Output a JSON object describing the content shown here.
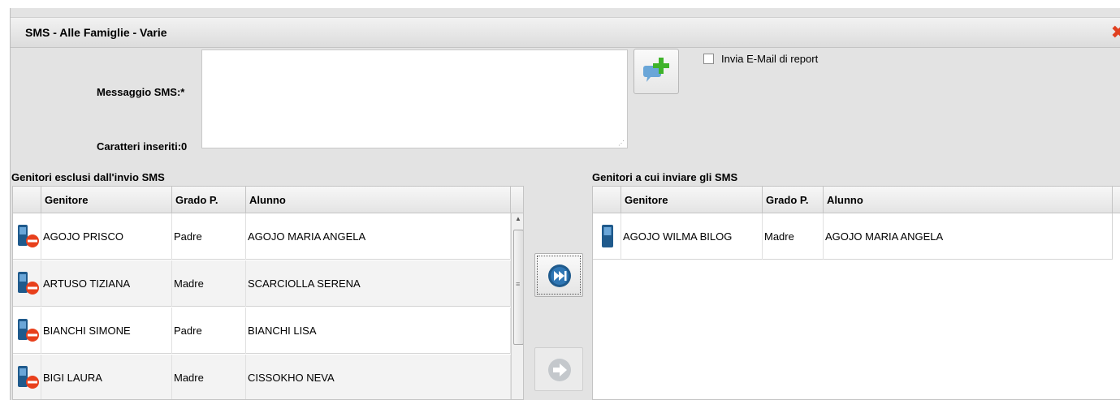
{
  "dialog": {
    "title": "SMS - Alle Famiglie - Varie",
    "close_icon": "close-x-icon"
  },
  "form": {
    "message_label": "Messaggio SMS:*",
    "message_value": "",
    "chars_label": "Caratteri inseriti:",
    "chars_count": "0",
    "add_template_icon": "speech-bubble-plus-icon",
    "email_report_label": "Invia E-Mail di report",
    "email_report_checked": false
  },
  "excluded": {
    "title": "Genitori esclusi dall'invio SMS",
    "columns": [
      "Genitore",
      "Grado P.",
      "Alunno"
    ],
    "rows": [
      {
        "genitore": "AGOJO PRISCO",
        "grado": "Padre",
        "alunno": "AGOJO MARIA ANGELA"
      },
      {
        "genitore": "ARTUSO TIZIANA",
        "grado": "Madre",
        "alunno": "SCARCIOLLA SERENA"
      },
      {
        "genitore": "BIANCHI SIMONE",
        "grado": "Padre",
        "alunno": "BIANCHI LISA"
      },
      {
        "genitore": "BIGI LAURA",
        "grado": "Madre",
        "alunno": "CISSOKHO NEVA"
      }
    ],
    "row_icon": "phone-blocked-icon"
  },
  "included": {
    "title": "Genitori a cui inviare gli SMS",
    "columns": [
      "Genitore",
      "Grado P.",
      "Alunno"
    ],
    "rows": [
      {
        "genitore": "AGOJO WILMA BILOG",
        "grado": "Madre",
        "alunno": "AGOJO MARIA ANGELA"
      }
    ],
    "row_icon": "phone-icon"
  },
  "actions": {
    "move_all_icon": "fast-forward-icon",
    "move_one_icon": "arrow-right-icon"
  },
  "colors": {
    "accent_blue": "#1f5a8c",
    "block_red": "#e8401c",
    "plus_green": "#3fb32a"
  }
}
